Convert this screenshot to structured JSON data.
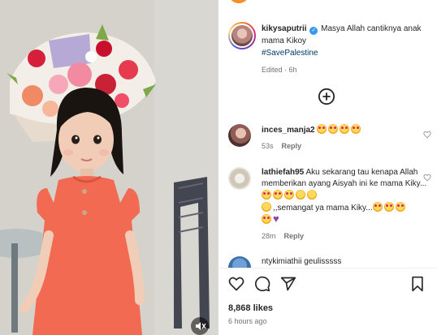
{
  "post": {
    "caption": {
      "username": "kikysaputrii",
      "text_line": "Masya Allah cantiknya anak mama Kikoy",
      "hashtag": "#SavePalestine",
      "edited": "Edited",
      "age": "6h"
    },
    "comments": [
      {
        "username": "inces_manja2",
        "emojis": [
          "heart-eyes",
          "heart-eyes",
          "heart-eyes",
          "heart-eyes"
        ],
        "age": "53s",
        "reply": "Reply"
      },
      {
        "username": "lathiefah95",
        "text": "Aku sekarang tau kenapa Allah memberikan ayang Aisyah ini ke mama Kiky...",
        "text2": ",,semangat ya mama Kiky...",
        "emojis1": [
          "heart-eyes",
          "heart-eyes",
          "heart-eyes",
          "smiling-face",
          "smiling-face"
        ],
        "emojis2": [
          "heart-eyes",
          "heart-eyes",
          "heart-eyes"
        ],
        "age": "28m",
        "reply": "Reply"
      },
      {
        "username": "ntykimiathii",
        "text": "geulisssss"
      }
    ],
    "likes": "8,868 likes",
    "time_ago": "6 hours ago"
  },
  "icons": {
    "like": "heart-icon",
    "comment": "comment-icon",
    "share": "share-icon",
    "save": "bookmark-icon",
    "load_more": "add-circle-icon",
    "verified": "verified-badge-icon",
    "mute": "mute-icon"
  },
  "colors": {
    "link": "#00376b",
    "verified": "#3897f0",
    "muted_text": "#737373",
    "dress": "#f26a52"
  }
}
